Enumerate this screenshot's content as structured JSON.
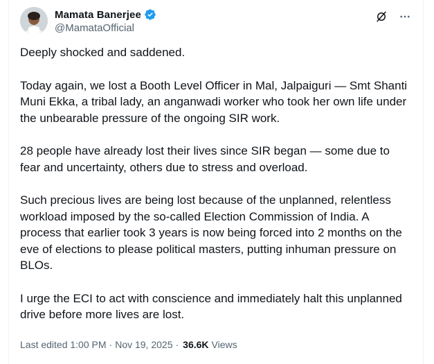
{
  "author": {
    "name": "Mamata Banerjee",
    "handle": "@MamataOfficial",
    "verified": true
  },
  "colors": {
    "verified_badge": "#1d9bf0",
    "text_primary": "#0f1419",
    "text_secondary": "#536471"
  },
  "icons": {
    "translate": "grok-translate-icon",
    "more": "more-dots-icon",
    "verified": "verified-badge-icon"
  },
  "post": {
    "paragraphs": [
      "Deeply shocked and saddened.",
      "Today again, we lost a Booth Level Officer in Mal, Jalpaiguri — Smt Shanti Muni Ekka, a tribal lady, an anganwadi worker who took her own life under the unbearable pressure of the ongoing SIR work.",
      "28 people have already lost their lives since SIR began — some due to fear and uncertainty, others due to stress and overload.",
      "Such precious lives are being lost because of the unplanned, relentless workload imposed by the so-called Election Commission of India. A process that earlier took 3 years is now being forced into 2 months on the eve of elections to please political masters, putting inhuman pressure on BLOs.",
      "I urge the ECI to act with conscience and immediately halt this unplanned drive before more lives are lost."
    ]
  },
  "meta": {
    "edited_label": "Last edited 1:00 PM",
    "separator": "·",
    "date": "Nov 19, 2025",
    "views_count": "36.6K",
    "views_label": "Views"
  }
}
